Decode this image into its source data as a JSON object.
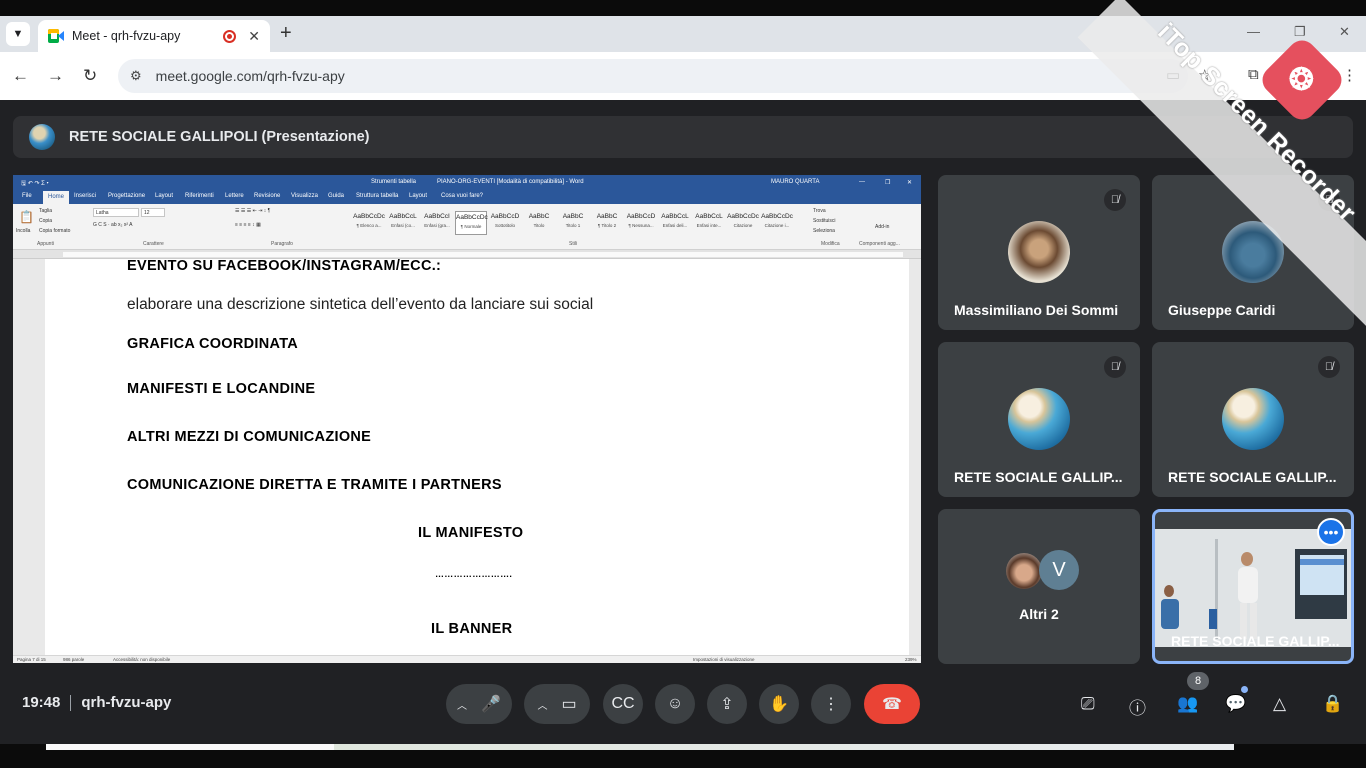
{
  "browser": {
    "tab_title": "Meet - qrh-fvzu-apy",
    "url": "meet.google.com/qrh-fvzu-apy",
    "new_tab_symbol": "+",
    "close_symbol": "✕"
  },
  "meet": {
    "presentation_title": "RETE SOCIALE GALLIPOLI (Presentazione)",
    "time": "19:48",
    "meeting_code": "qrh-fvzu-apy",
    "participants_count": "8",
    "accent_color": "#8ab4f8",
    "hangup_color": "#ea4335"
  },
  "word": {
    "title_center": "PIANO-ORG-EVENTI [Modalità di compatibilità] - Word",
    "tools_label": "Strumenti tabella",
    "user": "MAURO QUARTA",
    "tabs": [
      "File",
      "Home",
      "Inserisci",
      "Progettazione",
      "Layout",
      "Riferimenti",
      "Lettere",
      "Revisione",
      "Visualizza",
      "Guida",
      "Struttura tabella",
      "Layout",
      "Cosa vuoi fare?"
    ],
    "ribbon": {
      "paste": "Incolla",
      "cut": "Taglia",
      "copy": "Copia",
      "format_painter": "Copia formato",
      "font": "Latha",
      "size": "12",
      "groups": [
        "Appunti",
        "Carattere",
        "Paragrafo",
        "Stili",
        "Modifica",
        "Componenti agg..."
      ],
      "styles": [
        {
          "preview": "AaBbCcDc",
          "name": "¶ Elenco a..."
        },
        {
          "preview": "AaBbCcL",
          "name": "Enfasi (co..."
        },
        {
          "preview": "AaBbCcI",
          "name": "Enfasi (gra..."
        },
        {
          "preview": "AaBbCcDc",
          "name": "¶ Normale"
        },
        {
          "preview": "AaBbCcD",
          "name": "Sottotitolo"
        },
        {
          "preview": "AaBbC",
          "name": "Titolo"
        },
        {
          "preview": "AaBbC",
          "name": "Titolo 1"
        },
        {
          "preview": "AaBbC",
          "name": "¶ Titolo 2"
        },
        {
          "preview": "AaBbCcD",
          "name": "¶ Nessuna..."
        },
        {
          "preview": "AaBbCcL",
          "name": "Enfasi deli..."
        },
        {
          "preview": "AaBbCcL",
          "name": "Enfasi inte..."
        },
        {
          "preview": "AaBbCcDc",
          "name": "Citazione"
        },
        {
          "preview": "AaBbCcDc",
          "name": "Citazione i..."
        }
      ],
      "find": "Trova",
      "replace": "Sostituisci",
      "select": "Seleziona",
      "addins": "Add-in"
    },
    "document_lines": [
      "EVENTO SU FACEBOOK/INSTAGRAM/ECC.:",
      "elaborare una descrizione sintetica dell’evento da lanciare sui social",
      "GRAFICA COORDINATA",
      "MANIFESTI  E  LOCANDINE",
      "ALTRI  MEZZI  DI  COMUNICAZIONE",
      "COMUNICAZIONE  DIRETTA  E  TRAMITE  I  PARTNERS",
      "IL  MANIFESTO",
      "…………………….",
      "IL  BANNER"
    ],
    "status": {
      "page": "Pagina 7 di 15",
      "words": "986 parole",
      "accessibility": "Accessibilità: non disponibile",
      "display_settings": "Impostazioni di visualizzazione",
      "zoom": "239%"
    }
  },
  "participants": [
    {
      "name": "Massimiliano Dei Sommi",
      "muted": true
    },
    {
      "name": "Giuseppe Caridi",
      "muted": true
    },
    {
      "name": "RETE SOCIALE GALLIP...",
      "muted": true
    },
    {
      "name": "RETE SOCIALE GALLIP...",
      "muted": true
    },
    {
      "name": "Altri 2",
      "initial": "V"
    },
    {
      "name": "RETE SOCIALE GALLIP...",
      "video": true
    }
  ],
  "watermark": {
    "text": "iTop Screen Recorder",
    "logo_color": "#e5505e"
  }
}
